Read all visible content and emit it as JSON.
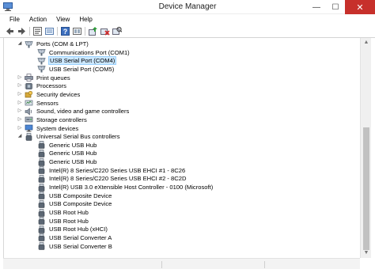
{
  "window": {
    "title": "Device Manager"
  },
  "controls": {
    "minimize": "—",
    "maximize": "☐",
    "close": "✕"
  },
  "menu": [
    "File",
    "Action",
    "View",
    "Help"
  ],
  "toolbar": [
    "back-icon",
    "forward-icon",
    "properties-icon",
    "device-list-icon",
    "help-icon",
    "show-hidden-icon",
    "update-driver-icon",
    "disable-device-icon",
    "scan-hardware-icon"
  ],
  "tree": {
    "rows": [
      {
        "label": "Ports (COM & LPT)",
        "level": 1,
        "state": "expanded",
        "icon": "port-icon"
      },
      {
        "label": "Communications Port (COM1)",
        "level": 2,
        "state": "leaf",
        "icon": "port-icon"
      },
      {
        "label": "USB Serial Port (COM4)",
        "level": 2,
        "state": "leaf",
        "icon": "port-icon",
        "selected": true
      },
      {
        "label": "USB Serial Port (COM5)",
        "level": 2,
        "state": "leaf",
        "icon": "port-icon"
      },
      {
        "label": "Print queues",
        "level": 1,
        "state": "collapsed",
        "icon": "printer-icon"
      },
      {
        "label": "Processors",
        "level": 1,
        "state": "collapsed",
        "icon": "processor-icon"
      },
      {
        "label": "Security devices",
        "level": 1,
        "state": "collapsed",
        "icon": "security-icon"
      },
      {
        "label": "Sensors",
        "level": 1,
        "state": "collapsed",
        "icon": "sensor-icon"
      },
      {
        "label": "Sound, video and game controllers",
        "level": 1,
        "state": "collapsed",
        "icon": "speaker-icon"
      },
      {
        "label": "Storage controllers",
        "level": 1,
        "state": "collapsed",
        "icon": "storage-icon"
      },
      {
        "label": "System devices",
        "level": 1,
        "state": "collapsed",
        "icon": "system-icon"
      },
      {
        "label": "Universal Serial Bus controllers",
        "level": 1,
        "state": "expanded",
        "icon": "usb-icon"
      },
      {
        "label": "Generic USB Hub",
        "level": 2,
        "state": "leaf",
        "icon": "usb-icon"
      },
      {
        "label": "Generic USB Hub",
        "level": 2,
        "state": "leaf",
        "icon": "usb-icon"
      },
      {
        "label": "Generic USB Hub",
        "level": 2,
        "state": "leaf",
        "icon": "usb-icon"
      },
      {
        "label": "Intel(R) 8 Series/C220 Series USB EHCI #1 - 8C26",
        "level": 2,
        "state": "leaf",
        "icon": "usb-icon"
      },
      {
        "label": "Intel(R) 8 Series/C220 Series USB EHCI #2 - 8C2D",
        "level": 2,
        "state": "leaf",
        "icon": "usb-icon"
      },
      {
        "label": "Intel(R) USB 3.0 eXtensible Host Controller - 0100 (Microsoft)",
        "level": 2,
        "state": "leaf",
        "icon": "usb-icon"
      },
      {
        "label": "USB Composite Device",
        "level": 2,
        "state": "leaf",
        "icon": "usb-icon"
      },
      {
        "label": "USB Composite Device",
        "level": 2,
        "state": "leaf",
        "icon": "usb-icon"
      },
      {
        "label": "USB Root Hub",
        "level": 2,
        "state": "leaf",
        "icon": "usb-icon"
      },
      {
        "label": "USB Root Hub",
        "level": 2,
        "state": "leaf",
        "icon": "usb-icon"
      },
      {
        "label": "USB Root Hub (xHCI)",
        "level": 2,
        "state": "leaf",
        "icon": "usb-icon"
      },
      {
        "label": "USB Serial Converter A",
        "level": 2,
        "state": "leaf",
        "icon": "usb-icon"
      },
      {
        "label": "USB Serial Converter B",
        "level": 2,
        "state": "leaf",
        "icon": "usb-icon"
      }
    ]
  },
  "colors": {
    "selection": "#cce8ff",
    "selection_border": "#99d1ff",
    "close_button": "#c7302b"
  }
}
